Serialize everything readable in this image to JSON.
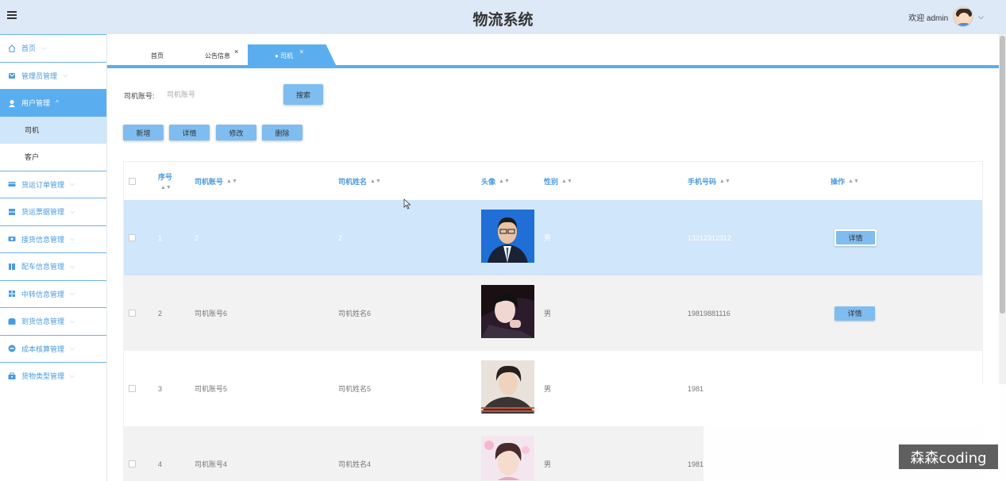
{
  "header": {
    "title": "物流系统",
    "welcome": "欢迎 admin",
    "caret": "⌵"
  },
  "sidebar": {
    "items": [
      {
        "label": "首页",
        "icon": "home-icon",
        "chev": "⌵"
      },
      {
        "label": "管理员管理",
        "icon": "admin-icon",
        "chev": "⌵"
      },
      {
        "label": "用户管理",
        "icon": "user-icon",
        "chev": "^",
        "active": true
      },
      {
        "label": "货运订单管理",
        "icon": "order-icon",
        "chev": "⌵"
      },
      {
        "label": "货运票据管理",
        "icon": "ticket-icon",
        "chev": "⌵"
      },
      {
        "label": "接货信息管理",
        "icon": "receive-icon",
        "chev": "⌵"
      },
      {
        "label": "配车信息管理",
        "icon": "vehicle-icon",
        "chev": "⌵"
      },
      {
        "label": "中转信息管理",
        "icon": "transfer-icon",
        "chev": "⌵"
      },
      {
        "label": "到货信息管理",
        "icon": "arrival-icon",
        "chev": "⌵"
      },
      {
        "label": "成本核算管理",
        "icon": "cost-icon",
        "chev": "⌵"
      },
      {
        "label": "货物类型管理",
        "icon": "goods-type-icon",
        "chev": "⌵"
      }
    ],
    "sub_items": [
      {
        "label": "司机",
        "active": true
      },
      {
        "label": "客户"
      }
    ]
  },
  "tabs": {
    "home": "首页",
    "notice": "公告信息",
    "driver": "● 司机",
    "close": "×"
  },
  "search": {
    "label": "司机账号:",
    "placeholder": "司机账号",
    "button": "搜索"
  },
  "actions": {
    "add": "新增",
    "detail": "详情",
    "edit": "修改",
    "delete": "删除"
  },
  "table": {
    "columns": {
      "index": "序号",
      "account": "司机账号",
      "name": "司机姓名",
      "avatar": "头像",
      "gender": "性别",
      "phone": "手机号码",
      "ops": "操作"
    },
    "sort_icon": "▲▼",
    "rows": [
      {
        "index": "1",
        "account": "2",
        "name": "2",
        "gender": "男",
        "phone": "13212312312",
        "detail": "详情"
      },
      {
        "index": "2",
        "account": "司机账号6",
        "name": "司机姓名6",
        "gender": "男",
        "phone": "19819881116",
        "detail": "详情"
      },
      {
        "index": "3",
        "account": "司机账号5",
        "name": "司机姓名5",
        "gender": "男",
        "phone": "1981",
        "detail": ""
      },
      {
        "index": "4",
        "account": "司机账号4",
        "name": "司机姓名4",
        "gender": "男",
        "phone": "1981",
        "detail": ""
      }
    ]
  },
  "watermark": "森森coding",
  "colors": {
    "accent": "#5aaef0",
    "header_bg": "#dde9f6",
    "selected_row": "#cfe6fb",
    "button": "#7fbdf0"
  }
}
